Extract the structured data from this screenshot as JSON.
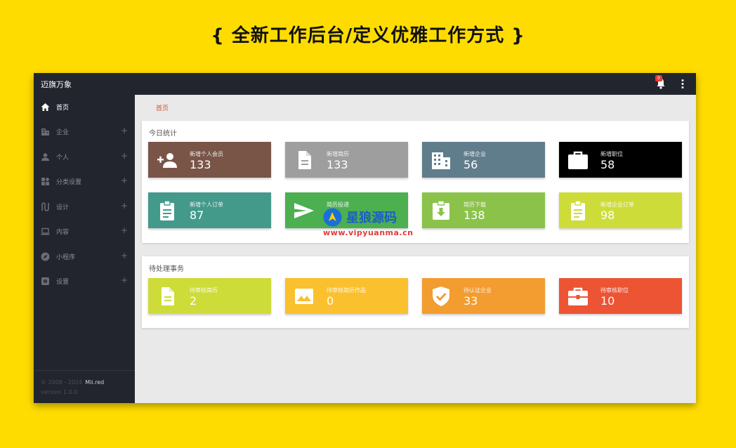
{
  "headline": "{ 全新工作后台/定义优雅工作方式 }",
  "app": {
    "title": "迈旗万象",
    "notification_count": "0"
  },
  "breadcrumb": "首页",
  "sidebar": {
    "items": [
      {
        "label": "首页",
        "icon": "home-icon",
        "active": true
      },
      {
        "label": "企业",
        "icon": "building-icon",
        "expand": "+"
      },
      {
        "label": "个人",
        "icon": "person-icon",
        "expand": "+"
      },
      {
        "label": "分类设置",
        "icon": "widgets-icon",
        "expand": "+"
      },
      {
        "label": "设计",
        "icon": "design-icon",
        "expand": "+"
      },
      {
        "label": "内容",
        "icon": "laptop-icon",
        "expand": "+"
      },
      {
        "label": "小程序",
        "icon": "compass-icon",
        "expand": "+"
      },
      {
        "label": "设置",
        "icon": "settings-icon",
        "expand": "+"
      }
    ],
    "footer": {
      "copyright": "© 2008 - 2024",
      "brand": "Mii.red",
      "version": "version 1.0.0"
    }
  },
  "today_stats": {
    "title": "今日统计",
    "cards": [
      {
        "label": "新增个人会员",
        "value": "133",
        "color": "#795548",
        "icon": "person-add-icon"
      },
      {
        "label": "新增简历",
        "value": "133",
        "color": "#9e9e9e",
        "icon": "document-icon"
      },
      {
        "label": "新增企业",
        "value": "56",
        "color": "#607d8b",
        "icon": "building-icon"
      },
      {
        "label": "新增职位",
        "value": "58",
        "color": "#000000",
        "icon": "briefcase-icon"
      },
      {
        "label": "新增个人订单",
        "value": "87",
        "color": "#439a8a",
        "icon": "clipboard-icon"
      },
      {
        "label": "简历投递",
        "value": "",
        "color": "#4caf50",
        "icon": "send-icon"
      },
      {
        "label": "简历下载",
        "value": "138",
        "color": "#8bc34a",
        "icon": "download-icon"
      },
      {
        "label": "新增企业订单",
        "value": "98",
        "color": "#cddc39",
        "icon": "clipboard-icon"
      }
    ]
  },
  "pending": {
    "title": "待处理事务",
    "cards": [
      {
        "label": "待审核简历",
        "value": "2",
        "color": "#cddc39",
        "icon": "document-icon"
      },
      {
        "label": "待审核简历作品",
        "value": "0",
        "color": "#fbc02d",
        "icon": "image-icon"
      },
      {
        "label": "待认证企业",
        "value": "33",
        "color": "#f39c2f",
        "icon": "shield-check-icon"
      },
      {
        "label": "待审核职位",
        "value": "10",
        "color": "#ec5434",
        "icon": "briefcase-icon"
      }
    ]
  },
  "watermark": {
    "text": "星狼源码",
    "url": "www.vipyuanma.cn"
  }
}
